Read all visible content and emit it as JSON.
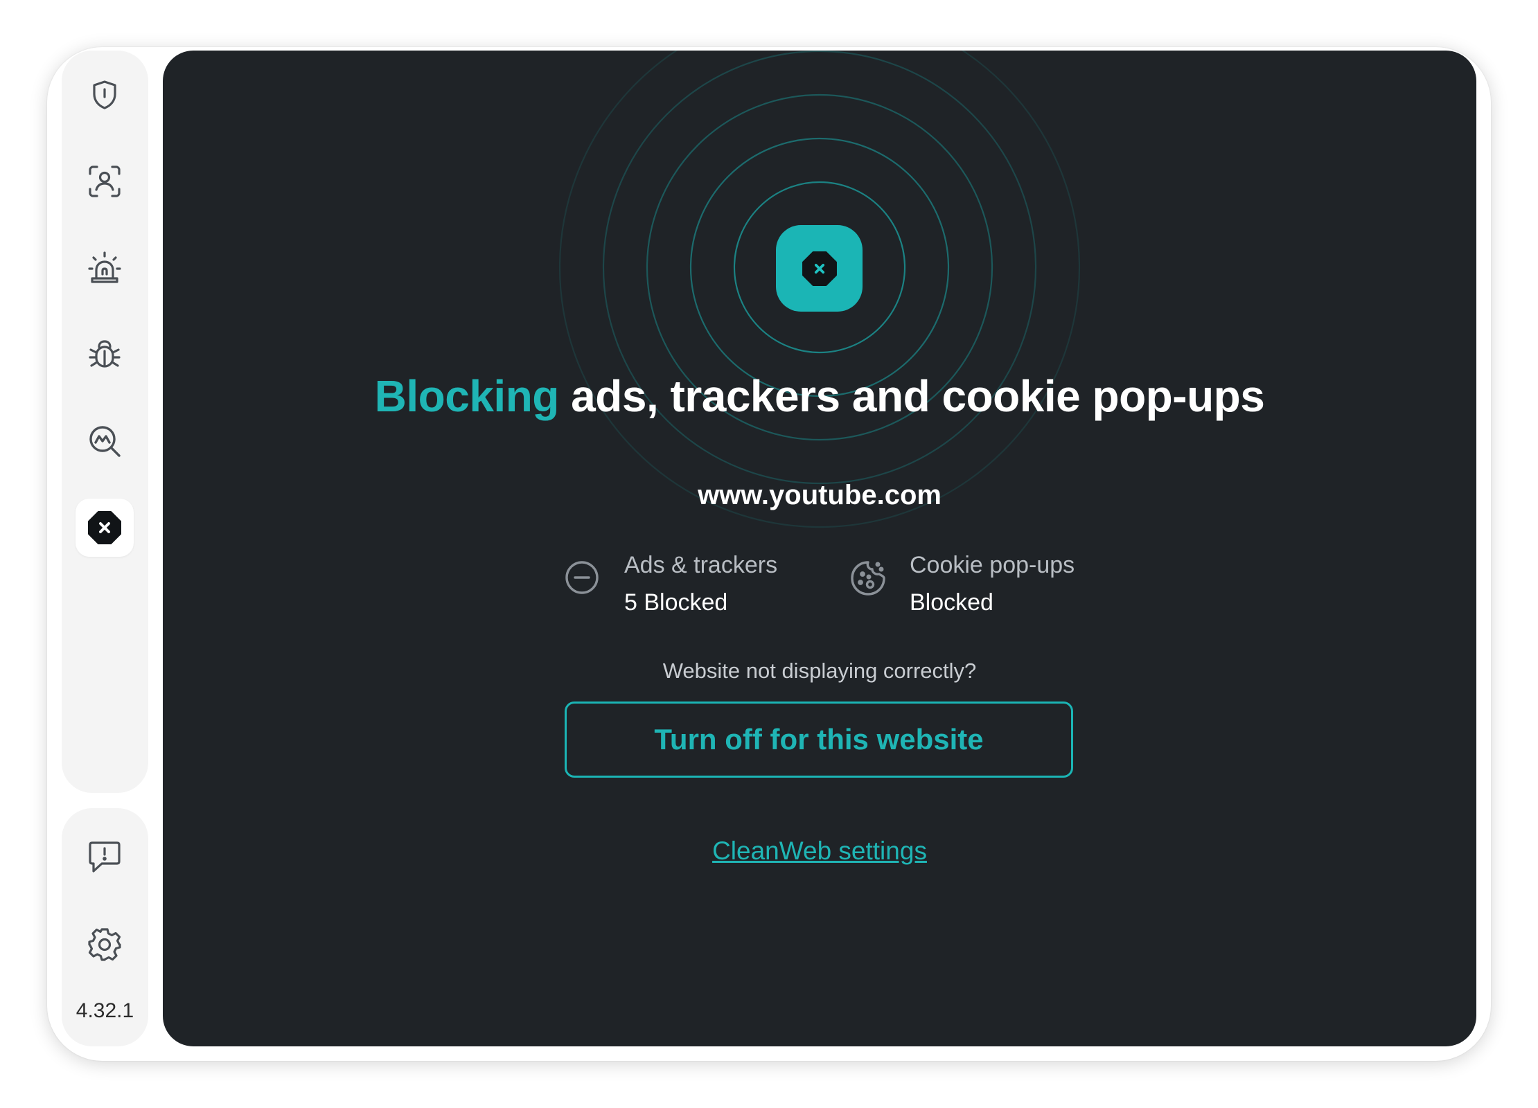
{
  "app": {
    "version": "4.32.1"
  },
  "sidebar": {
    "items": [
      {
        "icon": "shield-icon",
        "active": false
      },
      {
        "icon": "user-scan-icon",
        "active": false
      },
      {
        "icon": "alarm-icon",
        "active": false
      },
      {
        "icon": "bug-icon",
        "active": false
      },
      {
        "icon": "search-scan-icon",
        "active": false
      },
      {
        "icon": "cleanweb-block-icon",
        "active": true
      }
    ],
    "bottom_items": [
      {
        "icon": "feedback-icon"
      },
      {
        "icon": "gear-icon"
      }
    ]
  },
  "main": {
    "headline_accent": "Blocking",
    "headline_rest": "ads, trackers and cookie pop-ups",
    "domain": "www.youtube.com",
    "stats": [
      {
        "icon": "minus-circle-icon",
        "label": "Ads & trackers",
        "value": "5 Blocked"
      },
      {
        "icon": "cookie-icon",
        "label": "Cookie pop-ups",
        "value": "Blocked"
      }
    ],
    "question": "Website not displaying correctly?",
    "turn_off_label": "Turn off for this website",
    "settings_link": "CleanWeb settings"
  },
  "colors": {
    "accent": "#1bb5b5",
    "panel_background": "#1f2327",
    "sidebar_background": "#f4f4f4"
  }
}
